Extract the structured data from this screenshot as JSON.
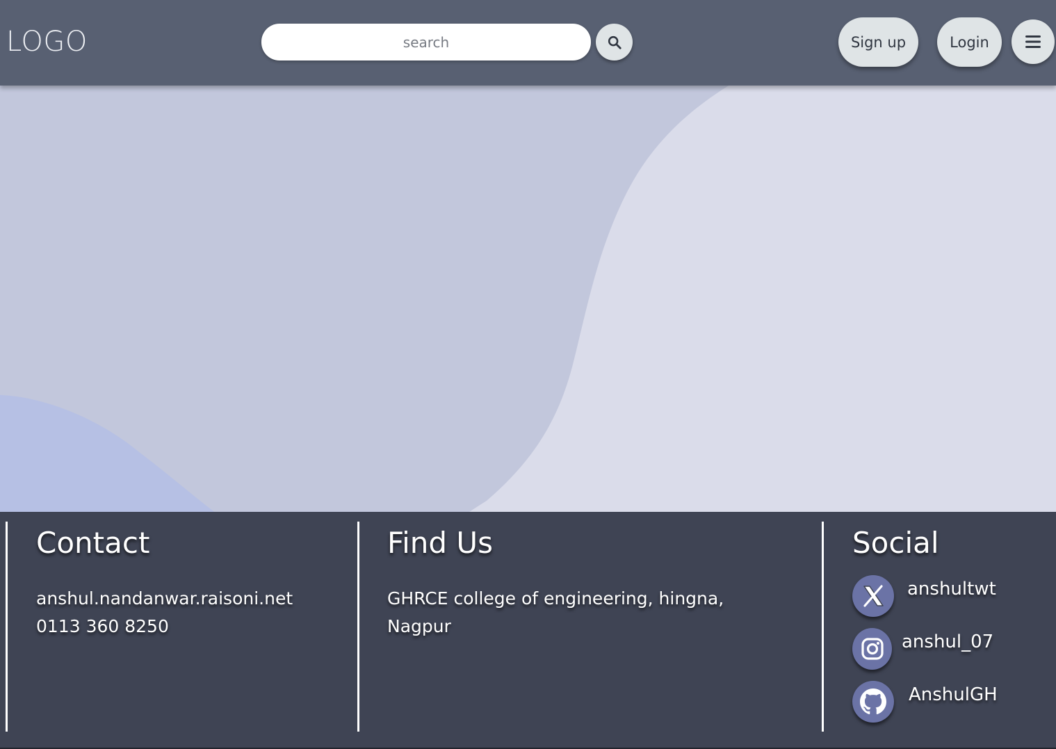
{
  "header": {
    "logo": "LOGO",
    "search_placeholder": "search",
    "signup_label": "Sign up",
    "login_label": "Login"
  },
  "icons": {
    "search": "search-icon",
    "menu": "hamburger-menu-icon",
    "twitter": "x-twitter-icon",
    "instagram": "instagram-icon",
    "github": "github-icon"
  },
  "footer": {
    "contact": {
      "heading": "Contact",
      "email": "anshul.nandanwar.raisoni.net",
      "phone": "0113 360 8250"
    },
    "find_us": {
      "heading": "Find Us",
      "address_line1": "GHRCE college of engineering, hingna,",
      "address_line2": "Nagpur"
    },
    "social": {
      "heading": "Social",
      "twitter": "anshultwt",
      "instagram": "anshul_07",
      "github": "AnshulGH"
    }
  },
  "colors": {
    "header_bg": "#586072",
    "footer_bg": "#3f4454",
    "page_bg_light": "#dadcea",
    "page_bg_mid": "#c2c7dc",
    "page_bg_blue": "#b6c0e4",
    "button_bg": "#dfe4e6",
    "social_icon_bg": "#6b73a6"
  }
}
